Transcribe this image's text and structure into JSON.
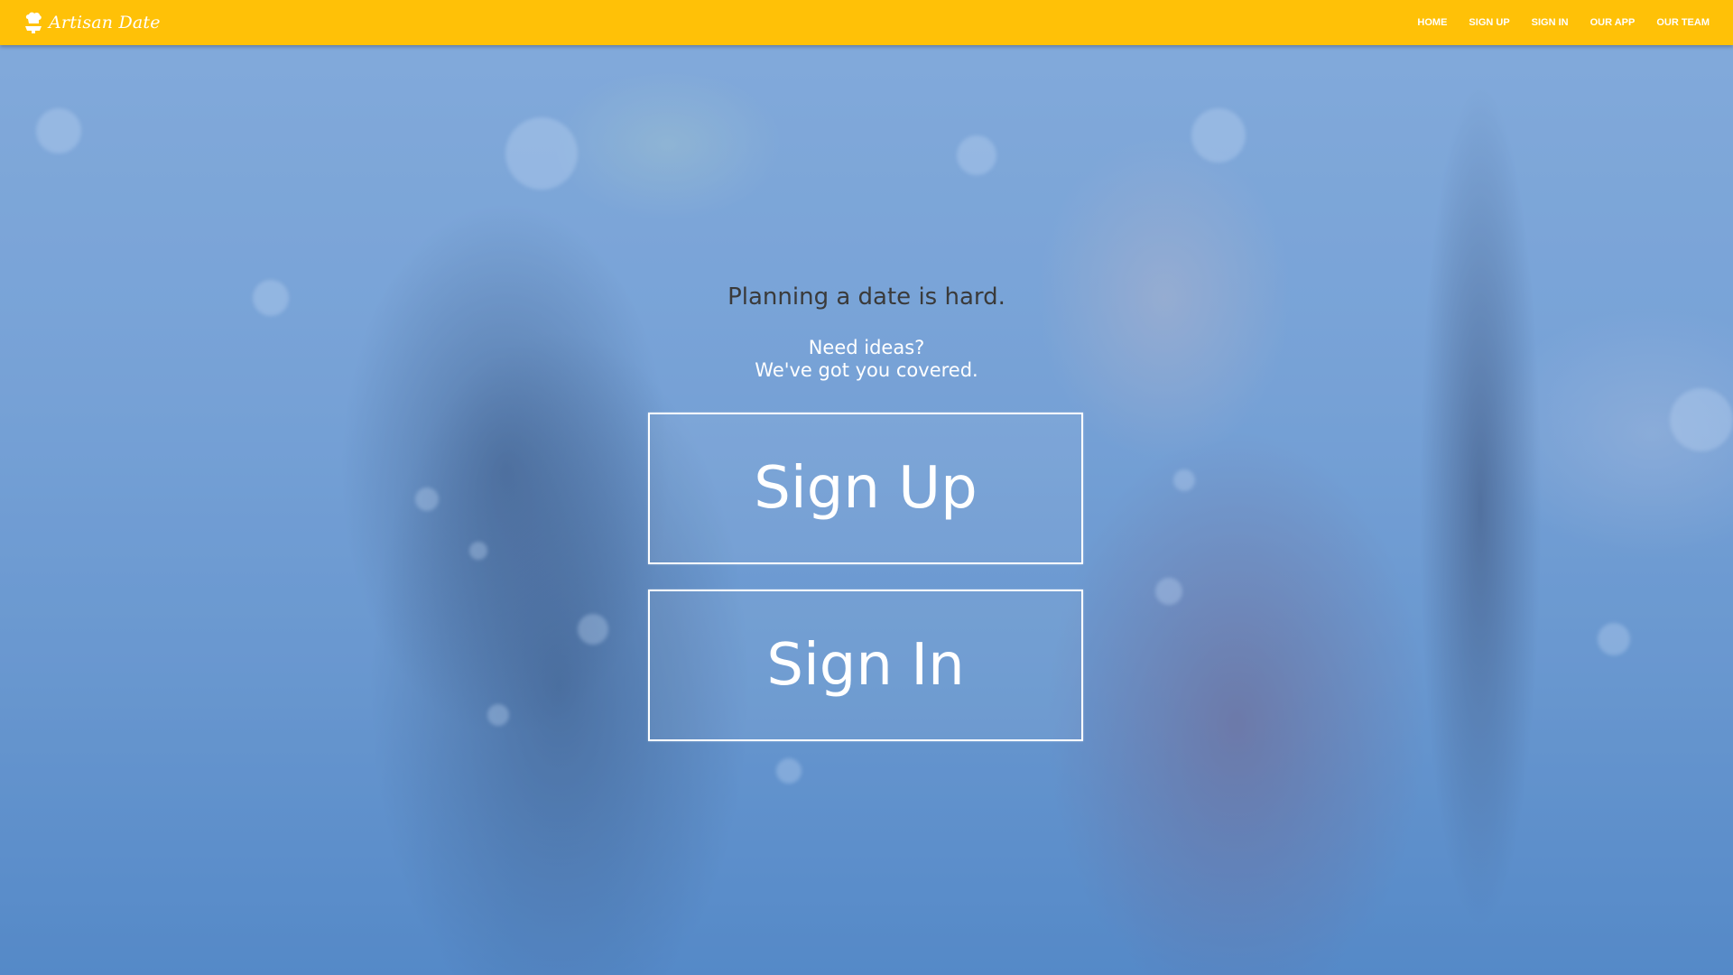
{
  "brand": {
    "name": "Artisan Date",
    "icon": "chef-hat-icon"
  },
  "nav": {
    "items": [
      {
        "label": "HOME"
      },
      {
        "label": "SIGN UP"
      },
      {
        "label": "SIGN IN"
      },
      {
        "label": "OUR APP"
      },
      {
        "label": "OUR TEAM"
      }
    ]
  },
  "hero": {
    "tagline": "Planning a date is hard.",
    "sub_line1": "Need ideas?",
    "sub_line2": "We've got you covered.",
    "signup_label": "Sign Up",
    "signin_label": "Sign In"
  },
  "colors": {
    "navbar": "#ffc107",
    "overlay": "#6496d7",
    "button_border": "#ffffff",
    "tagline_text": "#3a3a3a"
  }
}
